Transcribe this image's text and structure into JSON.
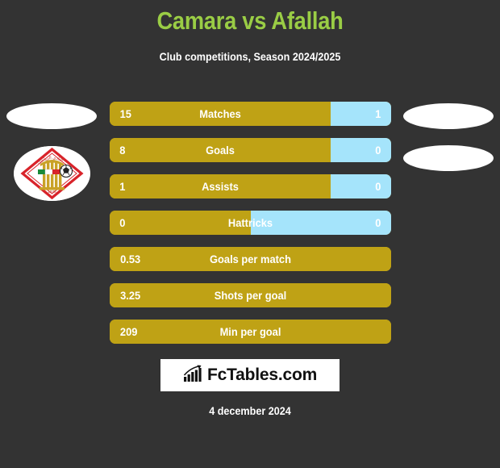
{
  "header": {
    "title": "Camara vs Afallah",
    "subtitle": "Club competitions, Season 2024/2025",
    "title_color": "#9ACD45"
  },
  "colors": {
    "background": "#333333",
    "home_bar": "#BFA215",
    "away_bar": "#A5E4FB",
    "text": "#FFFFFF"
  },
  "chart_data": {
    "type": "bar",
    "title": "Camara vs Afallah",
    "subtitle": "Club competitions, Season 2024/2025",
    "orientation": "horizontal",
    "series": [
      {
        "name": "Camara",
        "color": "#BFA215",
        "values": [
          15,
          8,
          1,
          0,
          0.53,
          3.25,
          209
        ]
      },
      {
        "name": "Afallah",
        "color": "#A5E4FB",
        "values": [
          1,
          0,
          0,
          0,
          null,
          null,
          null
        ]
      }
    ],
    "categories": [
      "Matches",
      "Goals",
      "Assists",
      "Hattricks",
      "Goals per match",
      "Shots per goal",
      "Min per goal"
    ],
    "legend": [
      "Camara",
      "Afallah"
    ],
    "grid": false
  },
  "stats": [
    {
      "label": "Matches",
      "home": "15",
      "away": "1",
      "home_pct": 78.5,
      "has_away": true
    },
    {
      "label": "Goals",
      "home": "8",
      "away": "0",
      "home_pct": 78.5,
      "has_away": true
    },
    {
      "label": "Assists",
      "home": "1",
      "away": "0",
      "home_pct": 78.5,
      "has_away": true
    },
    {
      "label": "Hattricks",
      "home": "0",
      "away": "0",
      "home_pct": 50,
      "has_away": true
    },
    {
      "label": "Goals per match",
      "home": "0.53",
      "away": "",
      "home_pct": 100,
      "has_away": false
    },
    {
      "label": "Shots per goal",
      "home": "3.25",
      "away": "",
      "home_pct": 100,
      "has_away": false
    },
    {
      "label": "Min per goal",
      "home": "209",
      "away": "",
      "home_pct": 100,
      "has_away": false
    }
  ],
  "footer": {
    "logo_text": "FcTables.com",
    "logo_icon": "bar-chart-growth-icon",
    "date": "4 december 2024"
  },
  "crest": {
    "home_club_crest_icon": "club-crest-icon"
  }
}
